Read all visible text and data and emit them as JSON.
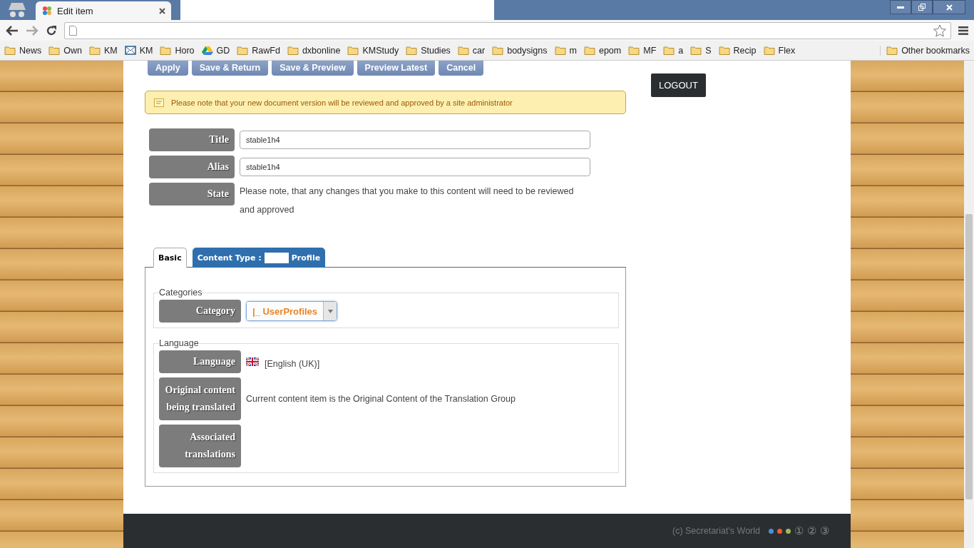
{
  "browser": {
    "tab": {
      "title": "Edit item"
    },
    "bookmarks": [
      {
        "label": "News",
        "kind": "folder"
      },
      {
        "label": "Own",
        "kind": "folder"
      },
      {
        "label": "KM",
        "kind": "folder"
      },
      {
        "label": "KM",
        "kind": "mail"
      },
      {
        "label": "Horo",
        "kind": "folder"
      },
      {
        "label": "GD",
        "kind": "drive"
      },
      {
        "label": "RawFd",
        "kind": "folder"
      },
      {
        "label": "dxbonline",
        "kind": "folder"
      },
      {
        "label": "KMStudy",
        "kind": "folder"
      },
      {
        "label": "Studies",
        "kind": "folder"
      },
      {
        "label": "car",
        "kind": "folder"
      },
      {
        "label": "bodysigns",
        "kind": "folder"
      },
      {
        "label": "m",
        "kind": "folder"
      },
      {
        "label": "epom",
        "kind": "folder"
      },
      {
        "label": "MF",
        "kind": "folder"
      },
      {
        "label": "a",
        "kind": "folder"
      },
      {
        "label": "S",
        "kind": "folder"
      },
      {
        "label": "Recip",
        "kind": "folder"
      },
      {
        "label": "Flex",
        "kind": "folder"
      }
    ],
    "other_bookmarks": "Other bookmarks"
  },
  "toolbar": {
    "buttons": [
      "Apply",
      "Save & Return",
      "Save & Preview",
      "Preview Latest",
      "Cancel"
    ]
  },
  "logout": "LOGOUT",
  "notice": "Please note that your new document version will be reviewed and approved by a site administrator",
  "fields": [
    {
      "label": "Title",
      "kind": "input",
      "value": "stable1h4"
    },
    {
      "label": "Alias",
      "kind": "input",
      "value": "stable1h4"
    },
    {
      "label": "State",
      "kind": "text",
      "value": "Please note, that any changes that you make to this content will need to be reviewed and approved"
    }
  ],
  "tabs": [
    {
      "label": "Basic",
      "selected": true
    },
    {
      "label": "Content Type :",
      "suffix": "Profile",
      "selected": false
    }
  ],
  "fieldsets": [
    {
      "legend": "Categories",
      "rows": [
        {
          "label": "Category",
          "kind": "select",
          "value": "|_ UserProfiles"
        }
      ]
    },
    {
      "legend": "Language",
      "rows": [
        {
          "label": "Language",
          "kind": "language",
          "value": "[English (UK)]"
        },
        {
          "label": "Original content being translated",
          "kind": "text",
          "value": "Current content item is the Original Content of the Translation Group"
        },
        {
          "label": "Associated translations",
          "kind": "empty"
        }
      ]
    }
  ],
  "footer": {
    "copyright": "(c) Secretariat's World",
    "dots": [
      {
        "color": "#4a90d9"
      },
      {
        "color": "#f0602a"
      },
      {
        "color": "#9dbb5c"
      }
    ],
    "pages": [
      "①",
      "②",
      "③"
    ]
  }
}
